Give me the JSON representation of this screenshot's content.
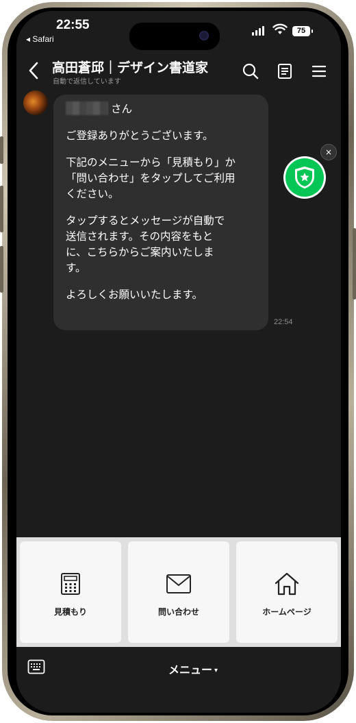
{
  "status_bar": {
    "time": "22:55",
    "back_app": "◂ Safari",
    "battery": "75"
  },
  "header": {
    "title": "高田蒼邱｜デザイン書道家",
    "subtitle": "自動で返信しています",
    "icons": [
      "back-chevron-icon",
      "search-icon",
      "notes-icon",
      "menu-icon"
    ]
  },
  "message": {
    "lines": [
      "さん",
      "",
      "ご登録ありがとうございます。",
      "",
      "下記のメニューから「見積もり」か",
      "「問い合わせ」をタップしてご利用",
      "ください。",
      "",
      "タップするとメッセージが自動で",
      "送信されます。その内容をもと",
      "に、こちらからご案内いたしま",
      "す。",
      "",
      "よろしくお願いいたします。"
    ],
    "time": "22:54"
  },
  "badge": {
    "close": "×",
    "accent": "#06c755"
  },
  "rich_menu": {
    "items": [
      {
        "label": "見積もり",
        "icon": "calculator-icon"
      },
      {
        "label": "問い合わせ",
        "icon": "envelope-icon"
      },
      {
        "label": "ホームページ",
        "icon": "home-icon"
      }
    ]
  },
  "bottom_bar": {
    "menu_label": "メニュー",
    "caret": "▾"
  }
}
